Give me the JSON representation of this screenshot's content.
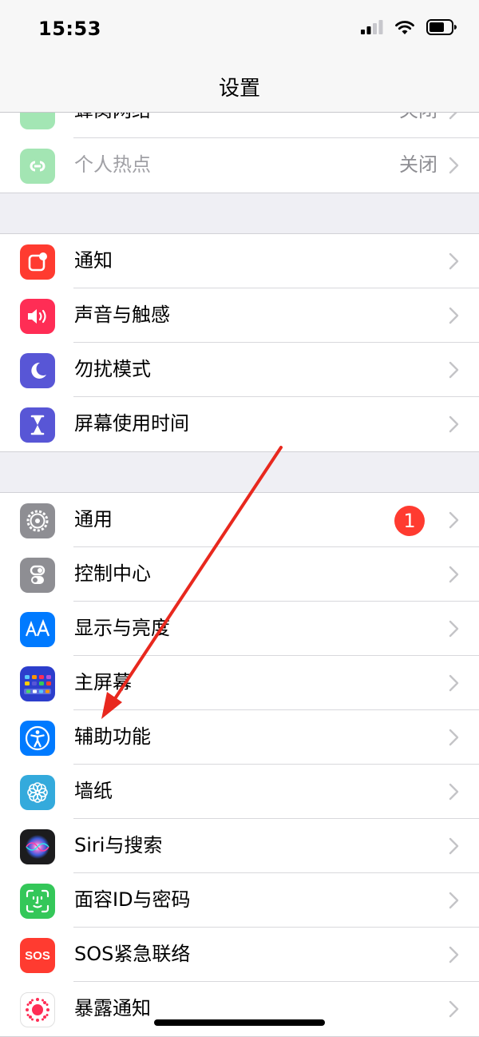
{
  "status_bar": {
    "time": "15:53"
  },
  "nav": {
    "title": "设置"
  },
  "group_network": {
    "partial_label": "蜂窝网络",
    "partial_value": "关闭",
    "hotspot_label": "个人热点",
    "hotspot_value": "关闭"
  },
  "group_notify": {
    "items": [
      {
        "label": "通知",
        "icon": "notification-icon",
        "color": "#ff3b30"
      },
      {
        "label": "声音与触感",
        "icon": "sound-icon",
        "color": "#ff2d55"
      },
      {
        "label": "勿扰模式",
        "icon": "moon-icon",
        "color": "#5856d6"
      },
      {
        "label": "屏幕使用时间",
        "icon": "hourglass-icon",
        "color": "#5856d6"
      }
    ]
  },
  "group_general": {
    "items": [
      {
        "label": "通用",
        "icon": "gear-icon",
        "color": "#8e8e93",
        "badge": "1"
      },
      {
        "label": "控制中心",
        "icon": "toggles-icon",
        "color": "#8e8e93"
      },
      {
        "label": "显示与亮度",
        "icon": "text-size-icon",
        "color": "#007aff"
      },
      {
        "label": "主屏幕",
        "icon": "home-grid-icon",
        "color": "#2c3ecc"
      },
      {
        "label": "辅助功能",
        "icon": "accessibility-icon",
        "color": "#007aff"
      },
      {
        "label": "墙纸",
        "icon": "flower-icon",
        "color": "#34aadc"
      },
      {
        "label": "Siri与搜索",
        "icon": "siri-icon",
        "color": "#1c1c1e"
      },
      {
        "label": "面容ID与密码",
        "icon": "face-id-icon",
        "color": "#34c759"
      },
      {
        "label": "SOS紧急联络",
        "icon": "sos-icon",
        "color": "#ff3b30",
        "icon_text": "SOS"
      },
      {
        "label": "暴露通知",
        "icon": "exposure-icon",
        "color": "#ffffff"
      }
    ]
  },
  "colors": {
    "annotation_arrow": "#e8281e",
    "badge": "#ff3b30"
  }
}
